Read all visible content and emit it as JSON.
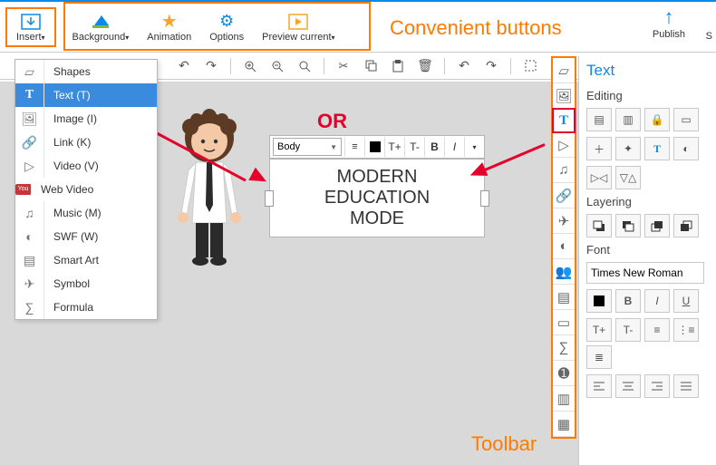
{
  "annotations": {
    "convenient": "Convenient buttons",
    "or": "OR",
    "toolbar": "Toolbar"
  },
  "topbar": {
    "insert": "Insert",
    "background": "Background",
    "animation": "Animation",
    "options": "Options",
    "preview": "Preview current",
    "publish": "Publish"
  },
  "dropdown": {
    "items": [
      {
        "label": "Shapes"
      },
      {
        "label": "Text (T)"
      },
      {
        "label": "Image (I)"
      },
      {
        "label": "Link (K)"
      },
      {
        "label": "Video (V)"
      },
      {
        "label": "Web Video"
      },
      {
        "label": "Music (M)"
      },
      {
        "label": "SWF (W)"
      },
      {
        "label": "Smart Art"
      },
      {
        "label": "Symbol"
      },
      {
        "label": "Formula"
      }
    ]
  },
  "canvas_text": {
    "line1": "MODERN",
    "line2": "EDUCATION",
    "line3": "MODE"
  },
  "text_toolbar": {
    "style": "Body",
    "size_up": "T+",
    "size_down": "T-",
    "bold": "B",
    "italic": "I"
  },
  "right_panel": {
    "title": "Text",
    "editing": "Editing",
    "layering": "Layering",
    "font": "Font",
    "font_family": "Times New Roman",
    "bold": "B",
    "italic": "I",
    "underline": "U",
    "tplus": "T+",
    "tminus": "T-"
  }
}
